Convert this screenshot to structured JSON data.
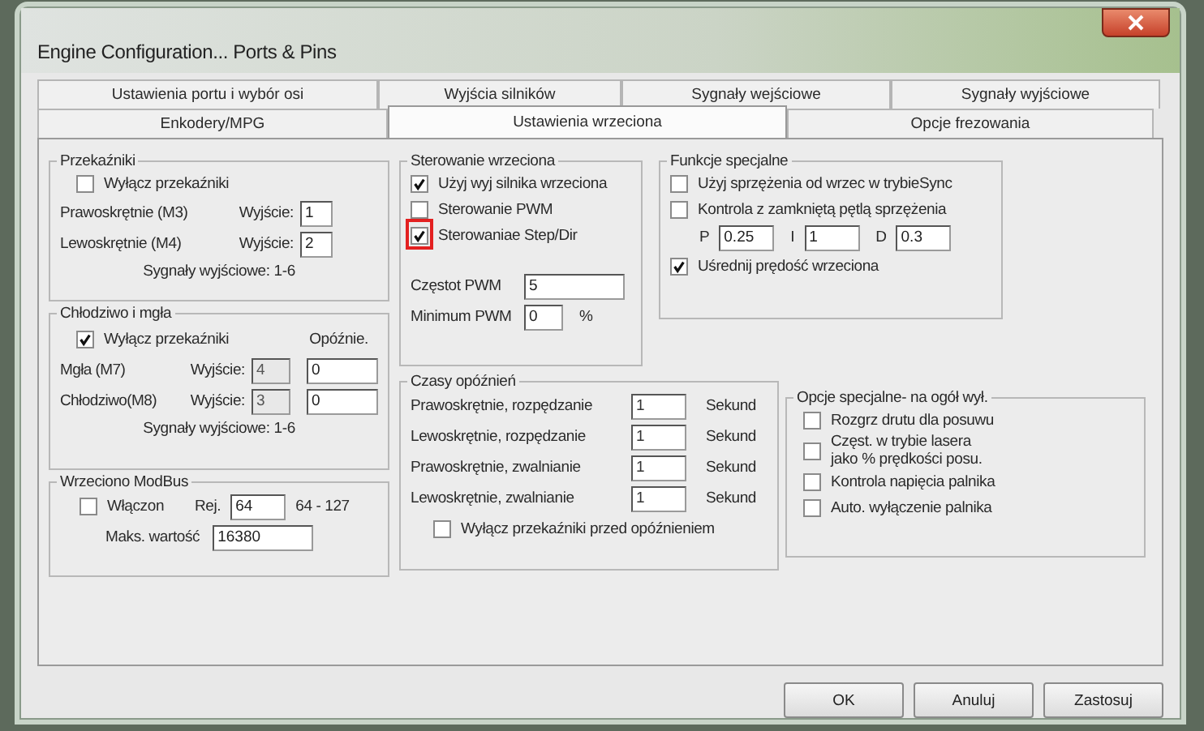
{
  "window": {
    "title": "Engine Configuration... Ports & Pins"
  },
  "tab_rows": [
    [
      {
        "label": "Ustawienia portu i wybór osi",
        "selected": false
      },
      {
        "label": "Wyjścia silników",
        "selected": false
      },
      {
        "label": "Sygnały wejściowe",
        "selected": false
      },
      {
        "label": "Sygnały wyjściowe",
        "selected": false
      }
    ],
    [
      {
        "label": "Enkodery/MPG",
        "selected": false
      },
      {
        "label": "Ustawienia wrzeciona",
        "selected": true
      },
      {
        "label": "Opcje frezowania",
        "selected": false
      }
    ]
  ],
  "relays": {
    "title": "Przekaźniki",
    "disable": {
      "label": "Wyłącz przekaźniki",
      "checked": false
    },
    "rows": [
      {
        "label": "Prawoskrętnie (M3)",
        "output_label": "Wyjście:",
        "value": "1"
      },
      {
        "label": "Lewoskrętnie (M4)",
        "output_label": "Wyjście:",
        "value": "2"
      }
    ],
    "note": "Sygnały wyjściowe: 1-6"
  },
  "coolant": {
    "title": "Chłodziwo i mgła",
    "disable": {
      "label": "Wyłącz przekaźniki",
      "checked": true
    },
    "delay_header": "Opóźnie.",
    "rows": [
      {
        "label": "Mgła (M7)",
        "output_label": "Wyjście:",
        "value": "4",
        "delay": "0"
      },
      {
        "label": "Chłodziwo(M8)",
        "output_label": "Wyjście:",
        "value": "3",
        "delay": "0"
      }
    ],
    "note": "Sygnały wyjściowe: 1-6"
  },
  "modbus": {
    "title": "Wrzeciono ModBus",
    "enable": {
      "label": "Włączon",
      "checked": false
    },
    "reg_label": "Rej.",
    "reg_value": "64",
    "range": "64 - 127",
    "max_label": "Maks. wartość",
    "max_value": "16380"
  },
  "spindle_control": {
    "title": "Sterowanie wrzeciona",
    "options": [
      {
        "label": "Użyj wyj silnika wrzeciona",
        "checked": true
      },
      {
        "label": "Sterowanie PWM",
        "checked": false
      },
      {
        "label": "Sterowaniae Step/Dir",
        "checked": true,
        "highlighted": true
      }
    ],
    "pwm_freq_label": "Częstot  PWM",
    "pwm_freq": "5",
    "pwm_min_label": "Minimum PWM",
    "pwm_min": "0",
    "pwm_min_unit": "%"
  },
  "special": {
    "title": "Funkcje specjalne",
    "options": [
      {
        "label": "Użyj sprzężenia od wrzec w trybieSync",
        "checked": false
      },
      {
        "label": "Kontrola z zamkniętą pętlą sprzężenia",
        "checked": false
      }
    ],
    "pid": [
      {
        "label": "P",
        "value": "0.25"
      },
      {
        "label": "I",
        "value": "1"
      },
      {
        "label": "D",
        "value": "0.3"
      }
    ],
    "average": {
      "label": "Uśrednij prędość wrzeciona",
      "checked": true
    }
  },
  "delays": {
    "title": "Czasy opóźnień",
    "rows": [
      {
        "label": "Prawoskrętnie, rozpędzanie",
        "value": "1",
        "unit": "Sekund"
      },
      {
        "label": "Lewoskrętnie, rozpędzanie",
        "value": "1",
        "unit": "Sekund"
      },
      {
        "label": "Prawoskrętnie, zwalnianie",
        "value": "1",
        "unit": "Sekund"
      },
      {
        "label": "Lewoskrętnie, zwalnianie",
        "value": "1",
        "unit": "Sekund"
      }
    ],
    "disable": {
      "label": "Wyłącz przekaźniki przed opóźnieniem",
      "checked": false
    }
  },
  "special_options": {
    "title": "Opcje specjalne- na ogół wył.",
    "options": [
      {
        "label": "Rozgrz drutu dla posuwu",
        "checked": false
      },
      {
        "label": "Częst. w trybie lasera\njako % prędkości posu.",
        "checked": false
      },
      {
        "label": "Kontrola napięcia palnika",
        "checked": false
      },
      {
        "label": "Auto. wyłączenie palnika",
        "checked": false
      }
    ]
  },
  "buttons": [
    {
      "label": "OK"
    },
    {
      "label": "Anuluj"
    },
    {
      "label": "Zastosuj"
    }
  ]
}
